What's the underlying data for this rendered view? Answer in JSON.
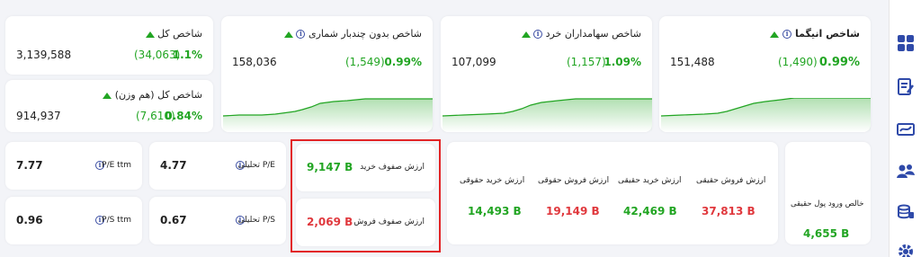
{
  "index_cards": [
    {
      "title": "شاخص کل",
      "value": "3,139,588",
      "change": "(34,063)",
      "pct": "1.1%"
    },
    {
      "title": "شاخص کل (هم وزن)",
      "value": "914,937",
      "change": "(7,610)",
      "pct": "0.84%"
    },
    {
      "title": "شاخص بدون چندبار شماری",
      "value": "158,036",
      "change": "(1,549)",
      "pct": "0.99%"
    },
    {
      "title": "شاخص سهامداران خرد",
      "value": "107,099",
      "change": "(1,157)",
      "pct": "1.09%"
    },
    {
      "title": "شاخص انیگما",
      "value": "151,488",
      "change": "(1,490)",
      "pct": "0.99%"
    }
  ],
  "ratios": {
    "pe_ttm_label": "P/E ttm",
    "pe_ttm": "7.77",
    "ps_ttm_label": "P/S ttm",
    "ps_ttm": "0.96",
    "pe_an_label": "P/E تحلیلی",
    "pe_an": "4.77",
    "ps_an_label": "P/S تحلیلی",
    "ps_an": "0.67"
  },
  "queues": {
    "buy_label": "ارزش صفوف خرید",
    "buy": "9,147 B",
    "sell_label": "ارزش صفوف فروش",
    "sell": "2,069 B"
  },
  "flows": [
    {
      "label": "ارزش خرید حقوقی",
      "value": "14,493 B",
      "color": "green"
    },
    {
      "label": "ارزش فروش حقوقی",
      "value": "19,149 B",
      "color": "red"
    },
    {
      "label": "ارزش خرید حقیقی",
      "value": "42,469 B",
      "color": "green"
    },
    {
      "label": "ارزش فروش حقیقی",
      "value": "37,813 B",
      "color": "red"
    }
  ],
  "net_flow": {
    "label": "خالص ورود پول حقیقی",
    "value": "4,655 B"
  },
  "colors": {
    "positive": "#22a523",
    "negative": "#e0383d",
    "brand": "#2f4aa9",
    "highlight": "#e22426"
  },
  "sidebar_icons": [
    "dashboard-icon",
    "report-icon",
    "ticket-icon",
    "users-icon",
    "coins-icon",
    "gear-icon"
  ]
}
